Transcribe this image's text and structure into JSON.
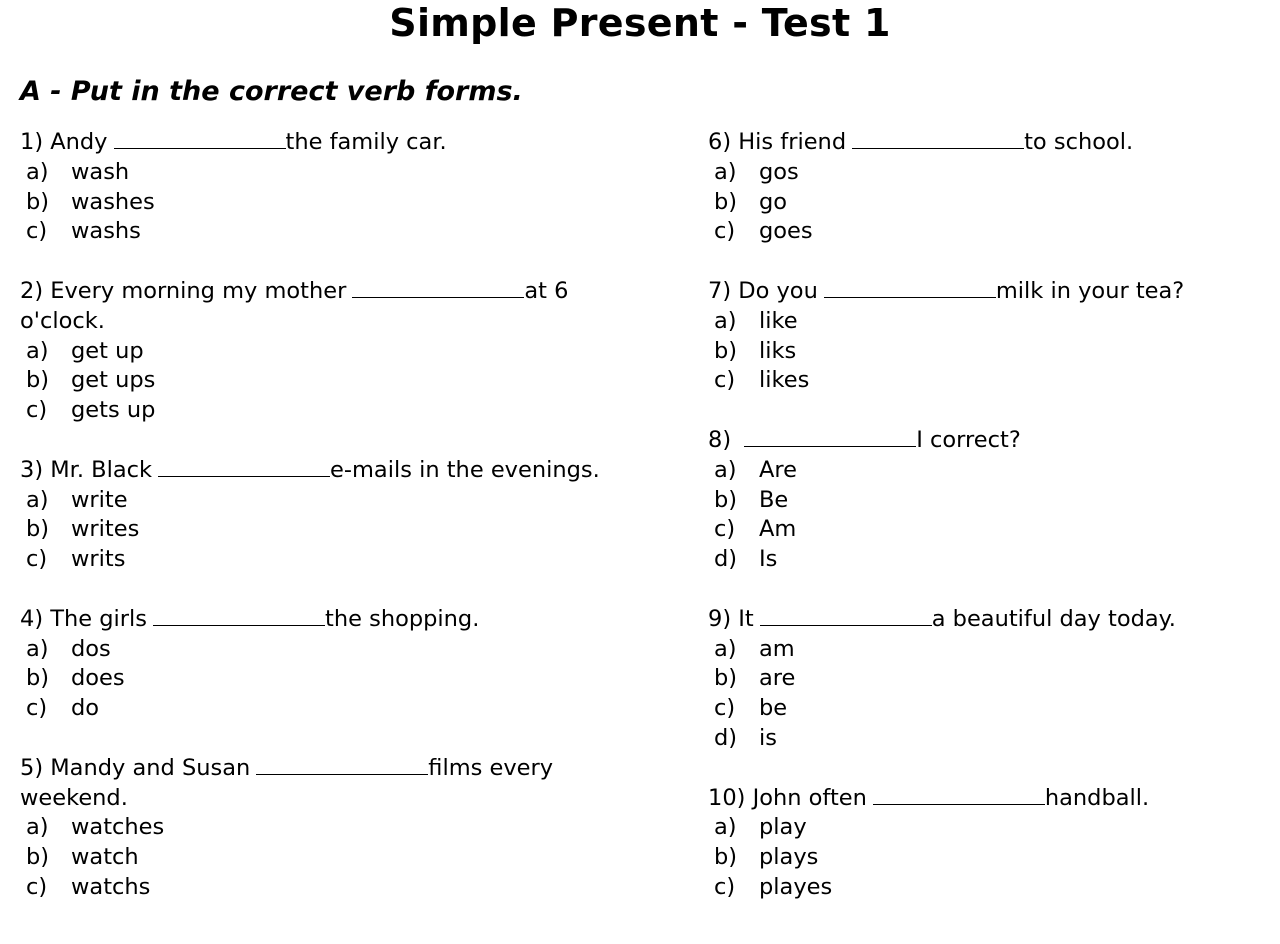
{
  "title": "Simple Present - Test 1",
  "section": "A - Put in the correct verb forms.",
  "questions": [
    {
      "num": "1)",
      "before": "Andy",
      "after": "the family car.",
      "options": [
        [
          "a)",
          "wash"
        ],
        [
          "b)",
          "washes"
        ],
        [
          "c)",
          "washs"
        ]
      ]
    },
    {
      "num": "2)",
      "before": "Every morning my mother",
      "after": "at 6 o'clock.",
      "options": [
        [
          "a)",
          "get up"
        ],
        [
          "b)",
          "get ups"
        ],
        [
          "c)",
          "gets up"
        ]
      ]
    },
    {
      "num": "3)",
      "before": "Mr. Black",
      "after": "e-mails in the evenings.",
      "options": [
        [
          "a)",
          "write"
        ],
        [
          "b)",
          "writes"
        ],
        [
          "c)",
          "writs"
        ]
      ]
    },
    {
      "num": "4)",
      "before": "The girls",
      "after": "the shopping.",
      "options": [
        [
          "a)",
          "dos"
        ],
        [
          "b)",
          "does"
        ],
        [
          "c)",
          "do"
        ]
      ]
    },
    {
      "num": "5)",
      "before": "Mandy and Susan",
      "after": "films every weekend.",
      "options": [
        [
          "a)",
          "watches"
        ],
        [
          "b)",
          "watch"
        ],
        [
          "c)",
          "watchs"
        ]
      ]
    },
    {
      "num": "6)",
      "before": "His friend",
      "after": "to school.",
      "options": [
        [
          "a)",
          "gos"
        ],
        [
          "b)",
          "go"
        ],
        [
          "c)",
          "goes"
        ]
      ]
    },
    {
      "num": "7)",
      "before": "Do you",
      "after": "milk in your tea?",
      "options": [
        [
          "a)",
          "like"
        ],
        [
          "b)",
          "liks"
        ],
        [
          "c)",
          "likes"
        ]
      ]
    },
    {
      "num": "8)",
      "before": "",
      "after": "I correct?",
      "options": [
        [
          "a)",
          "Are"
        ],
        [
          "b)",
          "Be"
        ],
        [
          "c)",
          "Am"
        ],
        [
          "d)",
          "Is"
        ]
      ]
    },
    {
      "num": "9)",
      "before": "It",
      "after": "a beautiful day today.",
      "options": [
        [
          "a)",
          "am"
        ],
        [
          "b)",
          "are"
        ],
        [
          "c)",
          "be"
        ],
        [
          "d)",
          "is"
        ]
      ]
    },
    {
      "num": "10)",
      "before": "John often",
      "after": "handball.",
      "options": [
        [
          "a)",
          "play"
        ],
        [
          "b)",
          "plays"
        ],
        [
          "c)",
          "playes"
        ]
      ]
    }
  ]
}
